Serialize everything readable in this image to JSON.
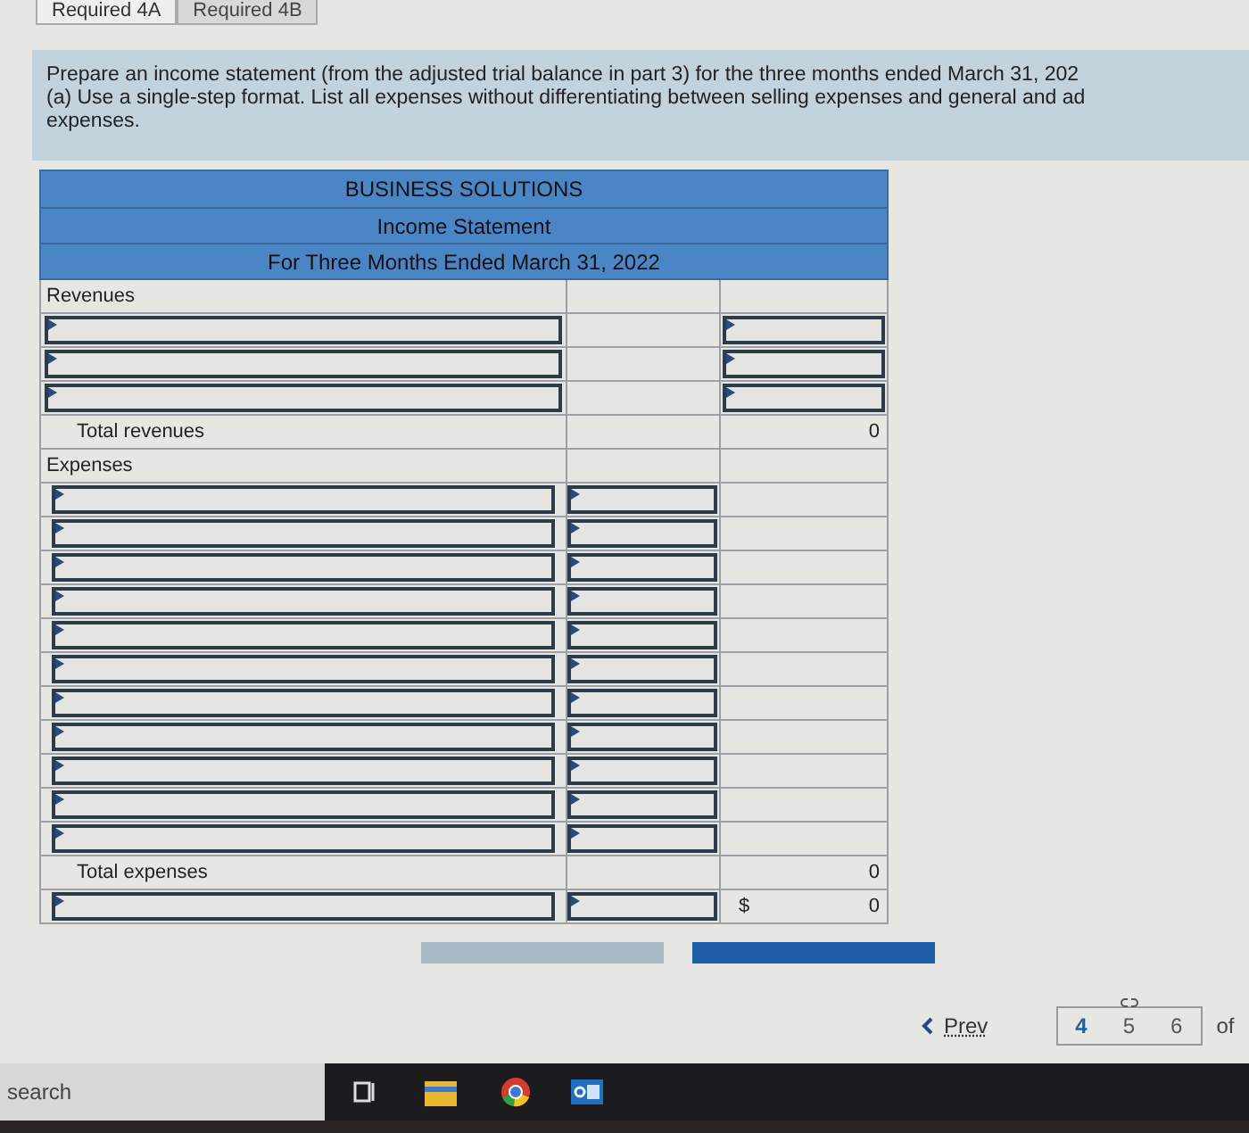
{
  "tabs": [
    {
      "label": "Required 4A",
      "selected": true
    },
    {
      "label": "Required 4B",
      "selected": false
    }
  ],
  "instructions": [
    "Prepare an income statement (from the adjusted trial balance in part 3) for the three months ended March 31, 202",
    "(a) Use a single-step format. List all expenses without differentiating between selling expenses and general and ad",
    "expenses."
  ],
  "statement": {
    "header": [
      "BUSINESS SOLUTIONS",
      "Income Statement",
      "For Three Months Ended March 31, 2022"
    ],
    "rows": [
      {
        "kind": "section",
        "label": "Revenues"
      },
      {
        "kind": "revenue_input"
      },
      {
        "kind": "revenue_input"
      },
      {
        "kind": "revenue_input"
      },
      {
        "kind": "total",
        "label": "Total revenues",
        "value": "0"
      },
      {
        "kind": "section",
        "label": "Expenses"
      },
      {
        "kind": "expense_input"
      },
      {
        "kind": "expense_input"
      },
      {
        "kind": "expense_input"
      },
      {
        "kind": "expense_input"
      },
      {
        "kind": "expense_input"
      },
      {
        "kind": "expense_input"
      },
      {
        "kind": "expense_input"
      },
      {
        "kind": "expense_input"
      },
      {
        "kind": "expense_input"
      },
      {
        "kind": "expense_input"
      },
      {
        "kind": "expense_input"
      },
      {
        "kind": "total",
        "label": "Total expenses",
        "value": "0"
      },
      {
        "kind": "net",
        "currency": "$",
        "value": "0"
      }
    ]
  },
  "nav_buttons": [
    {
      "kind": "back"
    },
    {
      "kind": "next"
    }
  ],
  "pagination": {
    "prev": "Prev",
    "pages": [
      {
        "label": "4",
        "selected": true
      },
      {
        "label": "5",
        "selected": false
      },
      {
        "label": "6",
        "selected": false
      }
    ],
    "of": "of"
  },
  "taskbar": {
    "search_placeholder": "search"
  }
}
